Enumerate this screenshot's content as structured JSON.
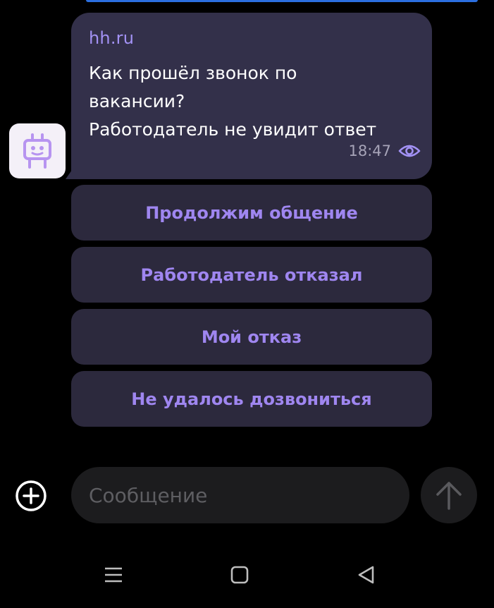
{
  "message": {
    "sender": "hh.ru",
    "text": "Как прошёл звонок по\nвакансии?\nРаботодатель не увидит ответ",
    "time": "18:47",
    "status_icon": "eye-icon"
  },
  "quick_replies": [
    {
      "label": "Продолжим общение"
    },
    {
      "label": "Работодатель отказал"
    },
    {
      "label": "Мой отказ"
    },
    {
      "label": "Не удалось дозвониться"
    }
  ],
  "composer": {
    "placeholder": "Сообщение",
    "add_icon": "plus-circle-icon",
    "send_icon": "arrow-up-icon"
  },
  "nav_bar": {
    "menu_icon": "menu-icon",
    "home_icon": "home-square-icon",
    "back_icon": "back-triangle-icon"
  },
  "colors": {
    "background": "#000000",
    "bubble": "#33304a",
    "accent_purple": "#9f86f0",
    "quick_reply_bg": "#2c293d",
    "input_bg": "#1c1c1e",
    "top_accent": "#2b6fe0"
  }
}
